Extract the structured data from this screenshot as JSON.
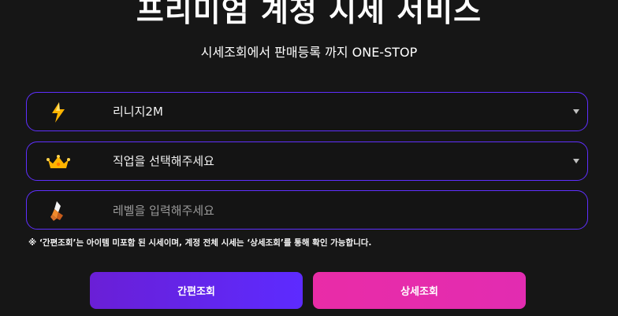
{
  "header": {
    "title": "프리미엄 계정 시세 서비스",
    "subtitle": "시세조회에서 판매등록 까지 ONE-STOP"
  },
  "form": {
    "game": {
      "value": "리니지2M",
      "icon": "lightning-icon",
      "color": "#ffb400"
    },
    "job": {
      "value": "직업을 선택해주세요",
      "icon": "crown-icon",
      "color": "#ffb400"
    },
    "level": {
      "placeholder": "레벨을 입력해주세요",
      "icon": "crystal-icon",
      "color": "#f08a2c"
    }
  },
  "notice": {
    "text": "※ ‘간편조회’는 아이템 미포함 된 시세이며, 계정 전체 시세는 ‘상세조회’를 통해 확인 가능합니다."
  },
  "actions": {
    "quick_label": "간편조회",
    "detail_label": "상세조회"
  },
  "colors": {
    "background": "#161616",
    "accent_purple": "#5f2fff",
    "accent_pink": "#e22cb1"
  }
}
